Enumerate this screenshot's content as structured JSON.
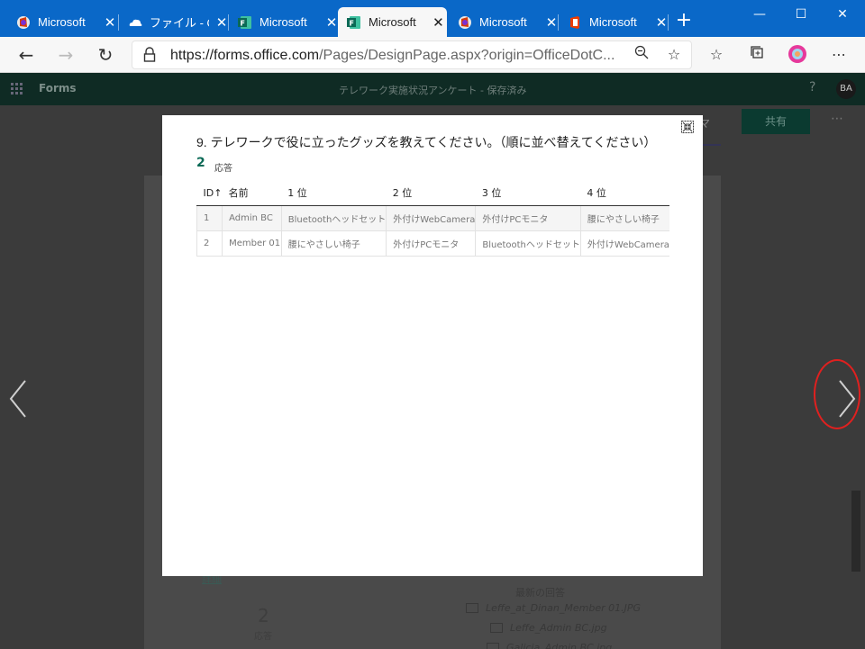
{
  "browser": {
    "tabs": [
      {
        "label": "Microsoft",
        "icon": "office-red-icon",
        "active": false
      },
      {
        "label": "ファイル - O",
        "icon": "onedrive-cloud-icon",
        "active": false
      },
      {
        "label": "Microsoft",
        "icon": "forms-icon",
        "active": false
      },
      {
        "label": "Microsoft",
        "icon": "forms-icon",
        "active": true
      },
      {
        "label": "Microsoft",
        "icon": "office-red-icon",
        "active": false
      },
      {
        "label": "Microsoft",
        "icon": "office-orange-icon",
        "active": false
      }
    ],
    "url_main": "https://forms.office.com",
    "url_rest": "/Pages/DesignPage.aspx?origin=OfficeDotC...",
    "colors": {
      "tab_strip": "#0a68c8",
      "accent": "#0b6a56",
      "highlight_circle": "#e0201f"
    }
  },
  "app": {
    "name": "Forms",
    "title": "テレワーク実施状況アンケート - 保存済み",
    "avatar": "BA",
    "share_label": "共有",
    "tab_fragment": "マ"
  },
  "background": {
    "response_count": "2",
    "response_label": "応答",
    "latest_label": "最新の回答",
    "files": [
      "Leffe_at_Dinan_Member 01.JPG",
      "Leffe_Admin BC.jpg",
      "Galicia_Admin BC.jpg"
    ],
    "link_fragment": "詳細"
  },
  "modal": {
    "question": "9. テレワークで役に立ったグッズを教えてください。（順に並べ替えてください）",
    "response_count": "2",
    "response_label": "応答",
    "columns": [
      "ID↑",
      "名前",
      "1 位",
      "2 位",
      "3 位",
      "4 位"
    ],
    "rows": [
      [
        "1",
        "Admin BC",
        "Bluetoothヘッドセット",
        "外付けWebCamera",
        "外付けPCモニタ",
        "腰にやさしい椅子"
      ],
      [
        "2",
        "Member 01",
        "腰にやさしい椅子",
        "外付けPCモニタ",
        "Bluetoothヘッドセット",
        "外付けWebCamera"
      ]
    ]
  }
}
